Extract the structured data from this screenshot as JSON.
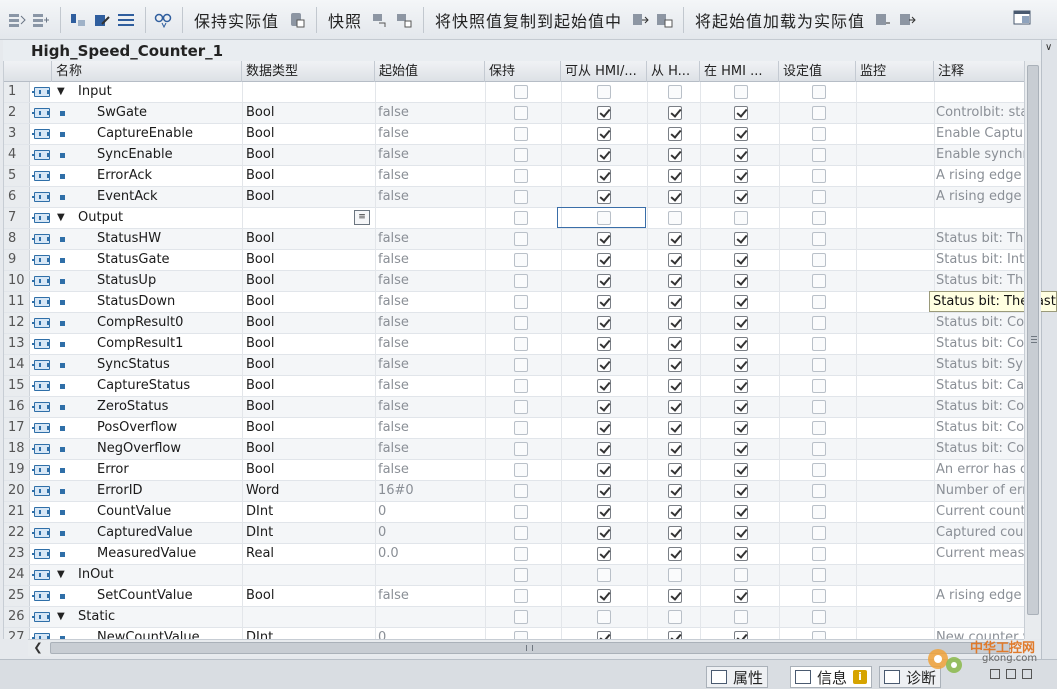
{
  "toolbar": {
    "keep_actual": "保持实际值",
    "snapshot": "快照",
    "copy_snapshot": "将快照值复制到起始值中",
    "load_start": "将起始值加载为实际值"
  },
  "block": {
    "title": "High_Speed_Counter_1"
  },
  "columns": {
    "name": "名称",
    "dtype": "数据类型",
    "start": "起始值",
    "retain": "保持",
    "hmi_access": "可从 HMI/...",
    "hmi_from": "从 H...",
    "hmi_visible": "在 HMI ...",
    "setpoint": "设定值",
    "monitor": "监控",
    "comment": "注释"
  },
  "rows": [
    {
      "n": "1",
      "name": "Input",
      "type": "",
      "start": "",
      "comment": "",
      "section": true,
      "c": [
        0,
        0,
        0,
        0,
        0
      ]
    },
    {
      "n": "2",
      "name": "SwGate",
      "type": "Bool",
      "start": "false",
      "comment": "Controlbit: star",
      "c": [
        0,
        1,
        1,
        1,
        0
      ]
    },
    {
      "n": "3",
      "name": "CaptureEnable",
      "type": "Bool",
      "start": "false",
      "comment": "Enable Captur",
      "c": [
        0,
        1,
        1,
        1,
        0
      ]
    },
    {
      "n": "4",
      "name": "SyncEnable",
      "type": "Bool",
      "start": "false",
      "comment": "Enable synchr",
      "c": [
        0,
        1,
        1,
        1,
        0
      ]
    },
    {
      "n": "5",
      "name": "ErrorAck",
      "type": "Bool",
      "start": "false",
      "comment": "A rising edge a",
      "c": [
        0,
        1,
        1,
        1,
        0
      ]
    },
    {
      "n": "6",
      "name": "EventAck",
      "type": "Bool",
      "start": "false",
      "comment": "A rising edge r",
      "c": [
        0,
        1,
        1,
        1,
        0
      ]
    },
    {
      "n": "7",
      "name": "Output",
      "type": "",
      "start": "",
      "comment": "",
      "section": true,
      "c": [
        0,
        0,
        0,
        0,
        0
      ]
    },
    {
      "n": "8",
      "name": "StatusHW",
      "type": "Bool",
      "start": "false",
      "comment": "Status bit: The",
      "c": [
        0,
        1,
        1,
        1,
        0
      ]
    },
    {
      "n": "9",
      "name": "StatusGate",
      "type": "Bool",
      "start": "false",
      "comment": "Status bit: Inte",
      "c": [
        0,
        1,
        1,
        1,
        0
      ]
    },
    {
      "n": "10",
      "name": "StatusUp",
      "type": "Bool",
      "start": "false",
      "comment": "Status bit: The",
      "c": [
        0,
        1,
        1,
        1,
        0
      ]
    },
    {
      "n": "11",
      "name": "StatusDown",
      "type": "Bool",
      "start": "false",
      "comment": "",
      "c": [
        0,
        1,
        1,
        1,
        0
      ]
    },
    {
      "n": "12",
      "name": "CompResult0",
      "type": "Bool",
      "start": "false",
      "comment": "Status bit: Con",
      "c": [
        0,
        1,
        1,
        1,
        0
      ]
    },
    {
      "n": "13",
      "name": "CompResult1",
      "type": "Bool",
      "start": "false",
      "comment": "Status bit: Con",
      "c": [
        0,
        1,
        1,
        1,
        0
      ]
    },
    {
      "n": "14",
      "name": "SyncStatus",
      "type": "Bool",
      "start": "false",
      "comment": "Status bit: Syn",
      "c": [
        0,
        1,
        1,
        1,
        0
      ]
    },
    {
      "n": "15",
      "name": "CaptureStatus",
      "type": "Bool",
      "start": "false",
      "comment": "Status bit: Cap",
      "c": [
        0,
        1,
        1,
        1,
        0
      ]
    },
    {
      "n": "16",
      "name": "ZeroStatus",
      "type": "Bool",
      "start": "false",
      "comment": "Status bit: Cou",
      "c": [
        0,
        1,
        1,
        1,
        0
      ]
    },
    {
      "n": "17",
      "name": "PosOverflow",
      "type": "Bool",
      "start": "false",
      "comment": "Status bit: Cou",
      "c": [
        0,
        1,
        1,
        1,
        0
      ]
    },
    {
      "n": "18",
      "name": "NegOverflow",
      "type": "Bool",
      "start": "false",
      "comment": "Status bit: Cou",
      "c": [
        0,
        1,
        1,
        1,
        0
      ]
    },
    {
      "n": "19",
      "name": "Error",
      "type": "Bool",
      "start": "false",
      "comment": "An error has o",
      "c": [
        0,
        1,
        1,
        1,
        0
      ]
    },
    {
      "n": "20",
      "name": "ErrorID",
      "type": "Word",
      "start": "16#0",
      "comment": "Number of erro",
      "c": [
        0,
        1,
        1,
        1,
        0
      ]
    },
    {
      "n": "21",
      "name": "CountValue",
      "type": "DInt",
      "start": "0",
      "comment": "Current counte",
      "c": [
        0,
        1,
        1,
        1,
        0
      ]
    },
    {
      "n": "22",
      "name": "CapturedValue",
      "type": "DInt",
      "start": "0",
      "comment": "Captured coun",
      "c": [
        0,
        1,
        1,
        1,
        0
      ]
    },
    {
      "n": "23",
      "name": "MeasuredValue",
      "type": "Real",
      "start": "0.0",
      "comment": "Current measu",
      "c": [
        0,
        1,
        1,
        1,
        0
      ]
    },
    {
      "n": "24",
      "name": "InOut",
      "type": "",
      "start": "",
      "comment": "",
      "section": true,
      "c": [
        0,
        0,
        0,
        0,
        0
      ]
    },
    {
      "n": "25",
      "name": "SetCountValue",
      "type": "Bool",
      "start": "false",
      "comment": "A rising edge s",
      "c": [
        0,
        1,
        1,
        1,
        0
      ]
    },
    {
      "n": "26",
      "name": "Static",
      "type": "",
      "start": "",
      "comment": "",
      "section": true,
      "c": [
        0,
        0,
        0,
        0,
        0
      ]
    },
    {
      "n": "27",
      "name": "NewCountValue",
      "type": "DInt",
      "start": "0",
      "comment": "New counter v",
      "c": [
        0,
        1,
        1,
        1,
        0
      ]
    }
  ],
  "tooltip": "Status bit: The last c",
  "statusbar": {
    "properties": "属性",
    "info": "信息",
    "diagnostics": "诊断"
  },
  "watermark": {
    "brand": "中华工控网",
    "url": "gkong.com"
  },
  "colors": {
    "accent": "#2f6fa8",
    "selection": "#3a6ea8",
    "tooltip_bg": "#ffffe1"
  }
}
